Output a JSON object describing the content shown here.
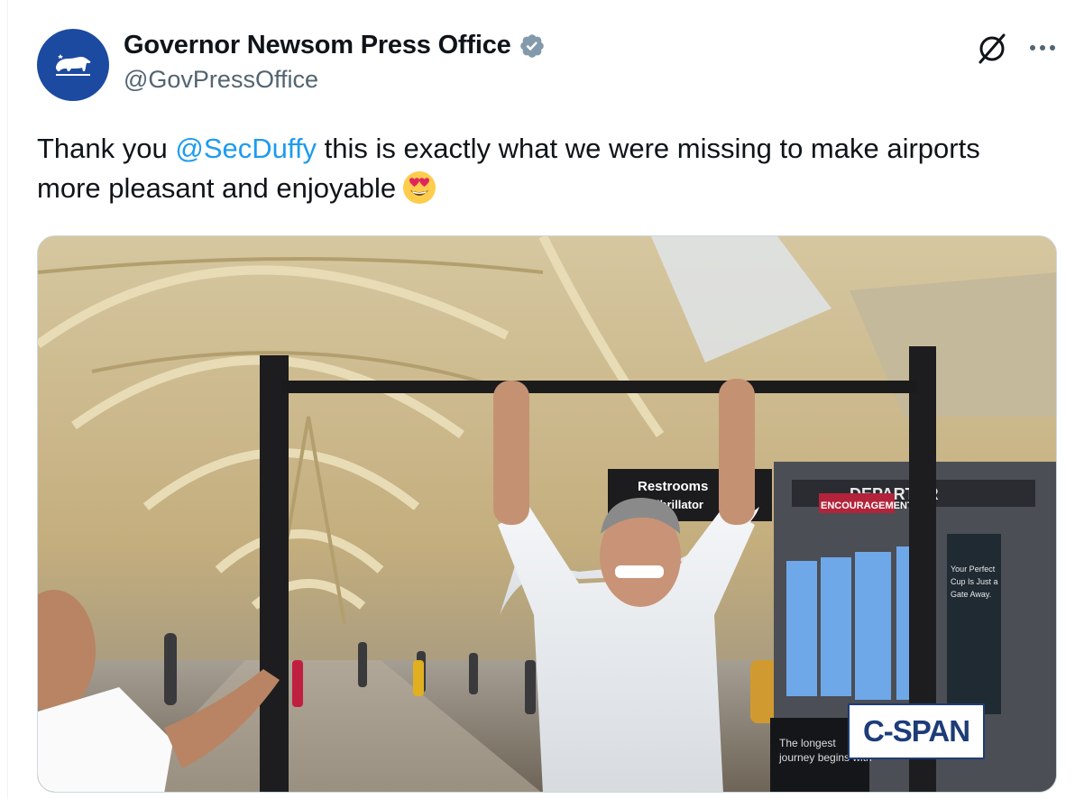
{
  "tweet": {
    "author": {
      "display_name": "Governor Newsom Press Office",
      "handle": "@GovPressOffice",
      "verified": true,
      "avatar_icon": "california-bear-icon",
      "avatar_color": "#1c4aa1"
    },
    "text_before": "Thank you ",
    "mention": "@SecDuffy",
    "text_after": " this is exactly what we were missing to make airports more pleasant and enjoyable",
    "emoji": "smiling-face-with-heart-eyes",
    "actions": {
      "grok_icon": "grok-icon",
      "more_icon": "more-icon"
    },
    "media": {
      "type": "video-still",
      "signs": {
        "restrooms": "Restrooms",
        "defibrillator": "Defibrillator",
        "departures": "DEPARTUR",
        "encouragement": "ENCOURAGEMENT",
        "ad_text_1": "Your Perfect",
        "ad_text_2": "Cup Is Just a",
        "ad_text_3": "Gate Away.",
        "kiosk_text_1": "The longest",
        "kiosk_text_2": "journey begins with"
      },
      "watermark": "C-SPAN"
    }
  },
  "colors": {
    "link": "#1d9bf0",
    "secondary_text": "#536471",
    "verified": "#829aab",
    "cspan": "#1d3c78"
  }
}
